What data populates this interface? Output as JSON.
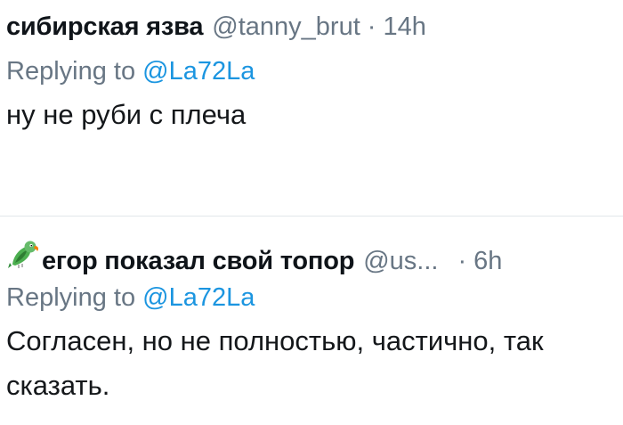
{
  "tweets": [
    {
      "display_name": "сибирская язва",
      "handle": "@tanny_brut",
      "separator": "·",
      "time": "14h",
      "reply_prefix": "Replying to",
      "reply_to": "@La72La",
      "text": "ну не руби с плеча"
    },
    {
      "avatar_emoji": "parrot-emoji",
      "display_name": "егор показал свой топор",
      "handle": "@us...",
      "separator": "·",
      "time": "6h",
      "reply_prefix": "Replying to",
      "reply_to": "@La72La",
      "text": "Согласен, но не полностью, частично, так сказать."
    }
  ],
  "colors": {
    "name": "#0f1419",
    "secondary": "#687684",
    "mention": "#1b95e0",
    "divider": "#e1e6ea"
  }
}
